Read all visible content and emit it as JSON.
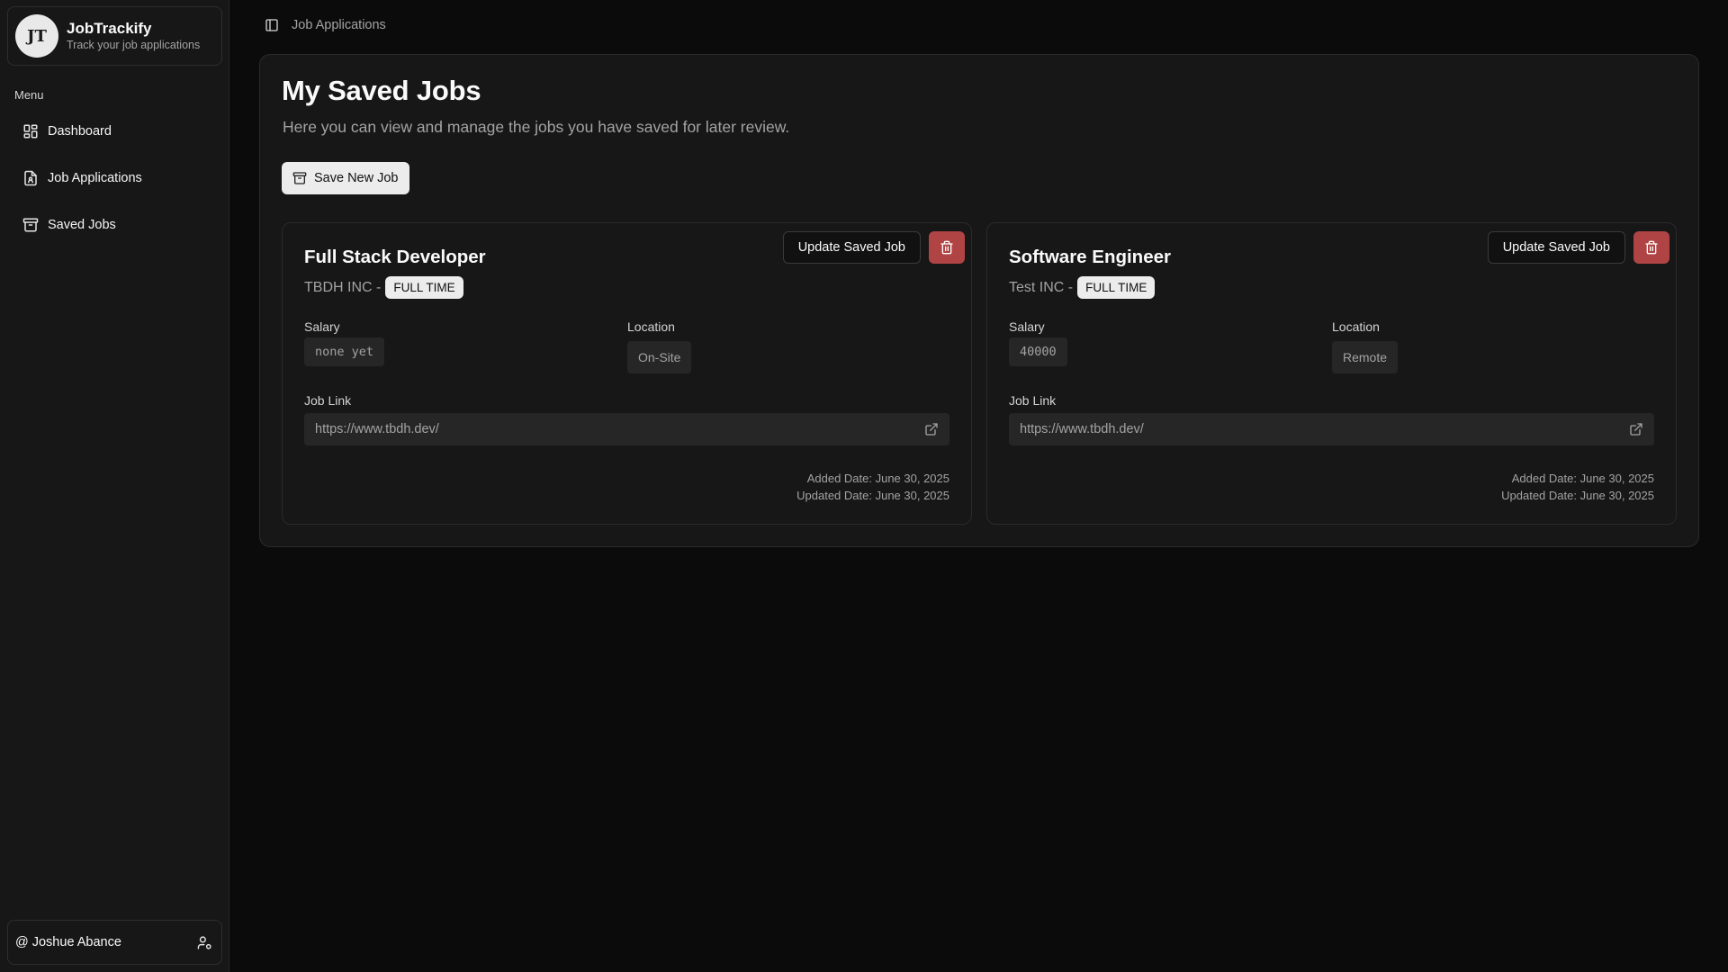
{
  "brand": {
    "logo_text": "JT",
    "name": "JobTrackify",
    "subtitle": "Track your job applications"
  },
  "sidebar": {
    "menu_label": "Menu",
    "items": [
      {
        "label": "Dashboard",
        "icon": "layout-dashboard-icon"
      },
      {
        "label": "Job Applications",
        "icon": "file-user-icon"
      },
      {
        "label": "Saved Jobs",
        "icon": "archive-icon"
      }
    ],
    "user": "@ Joshue Abance",
    "user_icon": "user-cog-icon"
  },
  "header": {
    "toggle_icon": "sidebar-toggle-icon",
    "breadcrumb": "Job Applications"
  },
  "main": {
    "title": "My Saved Jobs",
    "description": "Here you can view and manage the jobs you have saved for later review.",
    "save_new_label": "Save New Job"
  },
  "jobs": [
    {
      "title": "Full Stack Developer",
      "company": "TBDH INC -",
      "type": "FULL TIME",
      "salary_label": "Salary",
      "salary": "none yet",
      "location_label": "Location",
      "location": "On-Site",
      "link_label": "Job Link",
      "link": "https://www.tbdh.dev/",
      "update_label": "Update Saved Job",
      "added": "Added Date: June 30, 2025",
      "updated": "Updated Date: June 30, 2025"
    },
    {
      "title": "Software Engineer",
      "company": "Test INC -",
      "type": "FULL TIME",
      "salary_label": "Salary",
      "salary": "40000",
      "location_label": "Location",
      "location": "Remote",
      "link_label": "Job Link",
      "link": "https://www.tbdh.dev/",
      "update_label": "Update Saved Job",
      "added": "Added Date: June 30, 2025",
      "updated": "Updated Date: June 30, 2025"
    }
  ],
  "colors": {
    "background": "#0b0b0b",
    "sidebar": "#171717",
    "panel": "#171717",
    "danger": "#b04444",
    "badge": "#ececec"
  }
}
